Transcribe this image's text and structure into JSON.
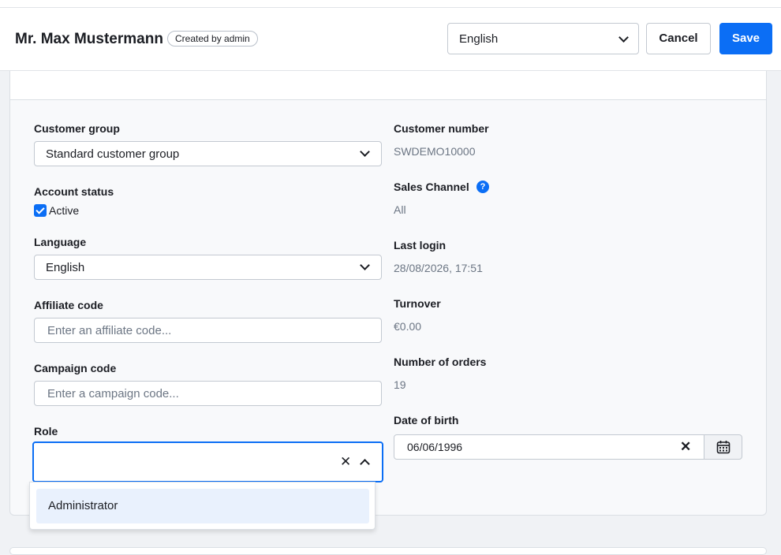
{
  "header": {
    "title": "Mr. Max Mustermann",
    "badge": "Created by admin",
    "language_select": "English",
    "cancel_label": "Cancel",
    "save_label": "Save"
  },
  "form": {
    "customer_group": {
      "label": "Customer group",
      "value": "Standard customer group"
    },
    "account_status": {
      "label": "Account status",
      "checkbox_label": "Active",
      "checked": true
    },
    "language": {
      "label": "Language",
      "value": "English"
    },
    "affiliate_code": {
      "label": "Affiliate code",
      "placeholder": "Enter an affiliate code..."
    },
    "campaign_code": {
      "label": "Campaign code",
      "placeholder": "Enter a campaign code..."
    },
    "role": {
      "label": "Role",
      "value": "",
      "options": [
        "Administrator"
      ]
    }
  },
  "info": {
    "customer_number": {
      "label": "Customer number",
      "value": "SWDEMO10000"
    },
    "sales_channel": {
      "label": "Sales Channel",
      "value": "All",
      "help": "?"
    },
    "last_login": {
      "label": "Last login",
      "value": "28/08/2026, 17:51"
    },
    "turnover": {
      "label": "Turnover",
      "value": "€0.00"
    },
    "number_of_orders": {
      "label": "Number of orders",
      "value": "19"
    },
    "date_of_birth": {
      "label": "Date of birth",
      "value": "06/06/1996"
    }
  },
  "colors": {
    "accent": "#0b6ef5"
  }
}
